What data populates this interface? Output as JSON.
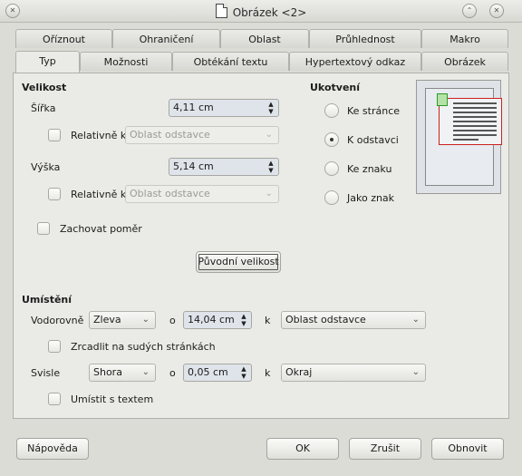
{
  "window": {
    "title": "Obrázek <2>"
  },
  "tabs_back": [
    "Oříznout",
    "Ohraničení",
    "Oblast",
    "Průhlednost",
    "Makro"
  ],
  "tabs_front": [
    "Typ",
    "Možnosti",
    "Obtékání textu",
    "Hypertextový odkaz",
    "Obrázek"
  ],
  "size": {
    "heading": "Velikost",
    "width_label": "Šířka",
    "width_value": "4,11 cm",
    "relative_label": "Relativně k",
    "relative_width_option": "Oblast odstavce",
    "height_label": "Výška",
    "height_value": "5,14 cm",
    "relative_height_option": "Oblast odstavce",
    "keep_ratio_label": "Zachovat poměr",
    "original_size_button": "Původní velikost"
  },
  "anchor": {
    "heading": "Ukotvení",
    "options": [
      "Ke stránce",
      "K odstavci",
      "Ke znaku",
      "Jako znak"
    ],
    "selected": "K odstavci"
  },
  "position": {
    "heading": "Umístění",
    "horizontal_label": "Vodorovně",
    "horizontal_value": "Zleva",
    "by_label": "o",
    "horizontal_by": "14,04 cm",
    "to_label": "k",
    "horizontal_to": "Oblast odstavce",
    "mirror_label": "Zrcadlit na sudých stránkách",
    "vertical_label": "Svisle",
    "vertical_value": "Shora",
    "vertical_by": "0,05 cm",
    "vertical_to": "Okraj",
    "follow_text_label": "Umístit s textem"
  },
  "buttons": {
    "help": "Nápověda",
    "ok": "OK",
    "cancel": "Zrušit",
    "reset": "Obnovit"
  },
  "colors": {
    "frame": "#cc2020",
    "image": "#2c9a2c",
    "panel": "#eaeae6"
  }
}
